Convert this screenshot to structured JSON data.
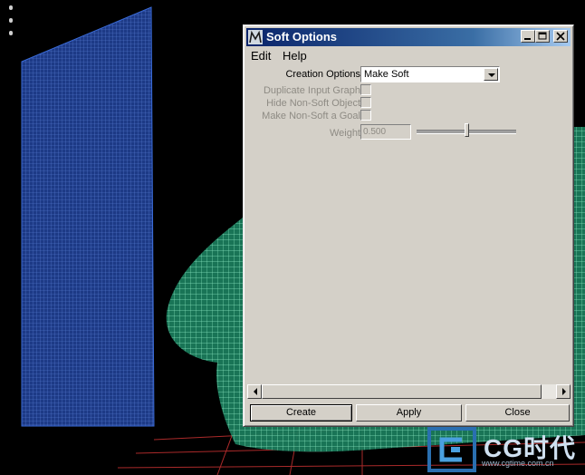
{
  "window": {
    "title": "Soft Options",
    "icon": "maya-app-icon",
    "controls": [
      "minimize-icon",
      "maximize-icon",
      "close-icon"
    ]
  },
  "menu": {
    "edit": "Edit",
    "help": "Help"
  },
  "form": {
    "creation_options_label": "Creation Options",
    "creation_options_value": "Make Soft",
    "duplicate_input_graph_label": "Duplicate Input Graph",
    "duplicate_input_graph_checked": false,
    "hide_non_soft_label": "Hide Non-Soft Object",
    "hide_non_soft_checked": false,
    "make_goal_label": "Make Non-Soft a Goal",
    "make_goal_checked": false,
    "weight_label": "Weight",
    "weight_value": "0.500",
    "weight_slider_fraction": 0.5
  },
  "buttons": {
    "create": "Create",
    "apply": "Apply",
    "close": "Close"
  },
  "watermark": {
    "brand": "CG时代",
    "url": "www.cgtime.com.cn"
  },
  "colors": {
    "dialog_bg": "#d4d0c8",
    "title_gradient_start": "#0a246a",
    "title_gradient_end": "#a6caf0",
    "mesh_blue": "#3a5bb0",
    "mesh_green": "#3fcf9a",
    "viewport_bg": "#000000"
  }
}
